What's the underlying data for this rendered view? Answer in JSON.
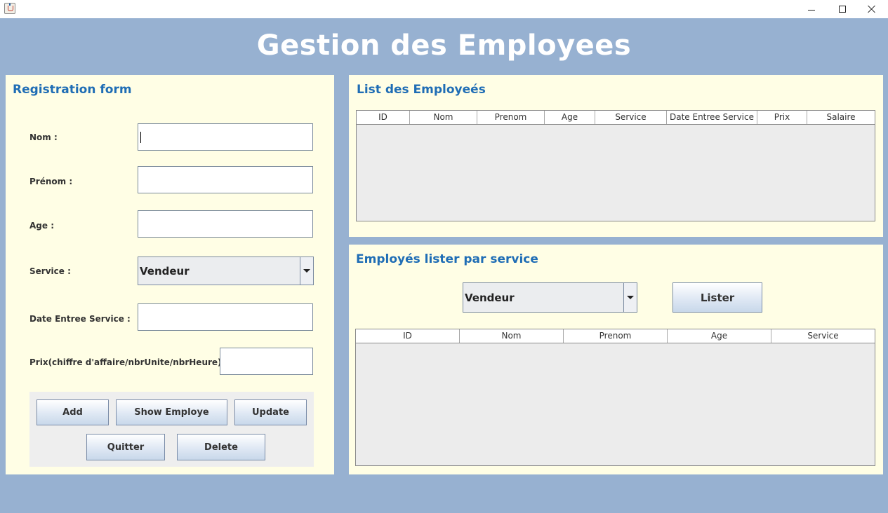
{
  "app": {
    "title": "Gestion des Employees"
  },
  "window": {
    "icon": "java-cup-icon",
    "controls": [
      "minimize-icon",
      "maximize-icon",
      "close-icon"
    ]
  },
  "registration": {
    "title": "Registration form",
    "fields": {
      "nom": {
        "label": "Nom :",
        "value": ""
      },
      "prenom": {
        "label": "Prénom :",
        "value": ""
      },
      "age": {
        "label": "Age  :",
        "value": ""
      },
      "service": {
        "label": "Service  :",
        "selected": "Vendeur"
      },
      "date": {
        "label": "Date Entree Service  :",
        "value": ""
      },
      "prix": {
        "label": "Prix(chiffre d'affaire/nbrUnite/nbrHeure) :",
        "value": ""
      }
    },
    "buttons": {
      "add": "Add",
      "show": "Show Employe",
      "update": "Update",
      "quitter": "Quitter",
      "delete": "Delete"
    }
  },
  "list": {
    "title": "List des Employeés",
    "columns": [
      "ID",
      "Nom",
      "Prenom",
      "Age",
      "Service",
      "Date Entree Service",
      "Prix",
      "Salaire"
    ],
    "rows": []
  },
  "by_service": {
    "title": "Employés lister par service",
    "selected": "Vendeur",
    "button": "Lister",
    "columns": [
      "ID",
      "Nom",
      "Prenom",
      "Age",
      "Service"
    ],
    "rows": []
  },
  "colors": {
    "background": "#97b1d1",
    "panel": "#fffee5",
    "title_accent": "#1f6db5"
  }
}
